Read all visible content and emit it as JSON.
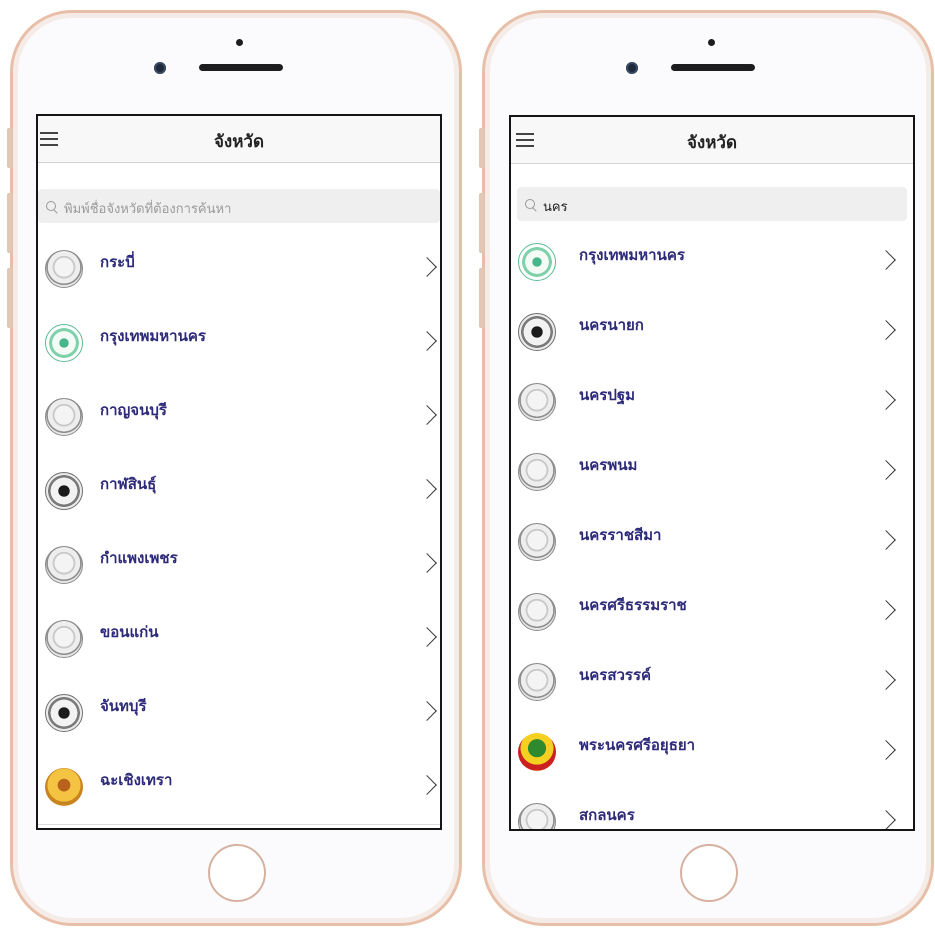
{
  "left": {
    "nav_title": "จังหวัด",
    "search": {
      "placeholder": "พิมพ์ชื่อจังหวัดที่ต้องการค้นหา",
      "value": ""
    },
    "provinces": [
      {
        "name": "กระบี่",
        "seal": "grey"
      },
      {
        "name": "กรุงเทพมหานคร",
        "seal": "green"
      },
      {
        "name": "กาญจนบุรี",
        "seal": "grey"
      },
      {
        "name": "กาฬสินธุ์",
        "seal": "dark"
      },
      {
        "name": "กำแพงเพชร",
        "seal": "grey"
      },
      {
        "name": "ขอนแก่น",
        "seal": "grey"
      },
      {
        "name": "จันทบุรี",
        "seal": "dark"
      },
      {
        "name": "ฉะเชิงเทรา",
        "seal": "gold"
      }
    ]
  },
  "right": {
    "nav_title": "จังหวัด",
    "search": {
      "placeholder": "",
      "value": "นคร"
    },
    "provinces": [
      {
        "name": "กรุงเทพมหานคร",
        "seal": "green"
      },
      {
        "name": "นครนายก",
        "seal": "dark"
      },
      {
        "name": "นครปฐม",
        "seal": "grey"
      },
      {
        "name": "นครพนม",
        "seal": "grey"
      },
      {
        "name": "นครราชสีมา",
        "seal": "grey"
      },
      {
        "name": "นครศรีธรรมราช",
        "seal": "grey"
      },
      {
        "name": "นครสวรรค์",
        "seal": "grey"
      },
      {
        "name": "พระนครศรีอยุธยา",
        "seal": "red"
      },
      {
        "name": "สกลนคร",
        "seal": "grey"
      }
    ]
  },
  "icons": {
    "menu": "hamburger-menu-icon",
    "search": "magnifier-icon",
    "row_disclosure": "chevron-right-icon",
    "row_seal": "province-seal-icon"
  }
}
